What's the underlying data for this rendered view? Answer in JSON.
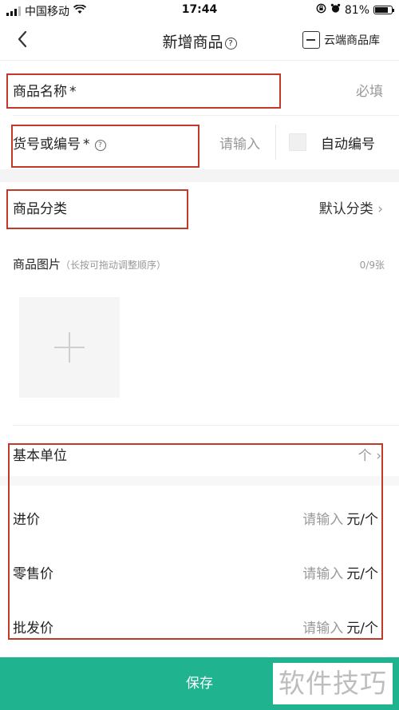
{
  "status_bar": {
    "carrier": "中国移动",
    "time": "17:44",
    "battery": "81%",
    "battery_level": 0.81
  },
  "nav": {
    "back_icon": "chevron-left-icon",
    "title": "新增商品",
    "help_icon_text": "?",
    "cloud_label": "云端商品库"
  },
  "form": {
    "name_label": "商品名称",
    "name_required": "*",
    "name_placeholder": "必填",
    "code_label": "货号或编号",
    "code_required": "*",
    "code_help": "?",
    "code_placeholder": "请输入",
    "auto_code_label": "自动编号",
    "category_label": "商品分类",
    "category_value": "默认分类",
    "category_arrow": "›",
    "image_label": "商品图片",
    "image_hint": "（长按可拖动调整顺序）",
    "image_count": "0/9张",
    "base_unit_label": "基本单位",
    "base_unit_value": "个",
    "base_unit_arrow": "›",
    "purchase_label": "进价",
    "purchase_placeholder": "请输入",
    "purchase_unit": "元/个",
    "retail_label": "零售价",
    "retail_placeholder": "请输入",
    "retail_unit": "元/个",
    "wholesale_label": "批发价",
    "wholesale_placeholder": "请输入",
    "wholesale_unit": "元/个"
  },
  "save_label": "保存",
  "watermark": "软件技巧",
  "colors": {
    "accent": "#1fb38f",
    "highlight_box": "#c0392b"
  }
}
